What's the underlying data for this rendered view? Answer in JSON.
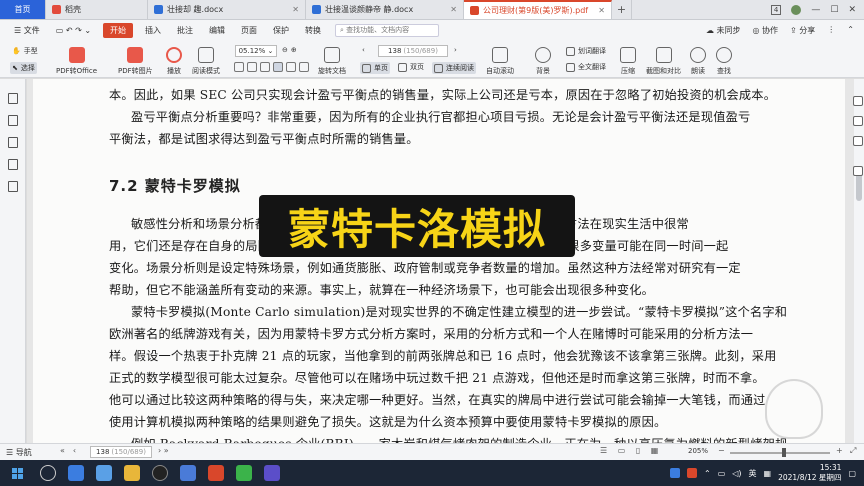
{
  "tabs": {
    "home": "首页",
    "wk": "稻壳",
    "doc1": "壮接却 趣.docx",
    "doc2": "壮接温谈颜静帝 静.docx",
    "pdf": "公司理财(第9版(美)罗斯).pdf",
    "plus": "+"
  },
  "window": {
    "count": "4"
  },
  "menu": {
    "file": "文件",
    "start": "开始",
    "insert": "插入",
    "comment": "批注",
    "edit": "编辑",
    "page": "页面",
    "protect": "保护",
    "convert": "转换",
    "search_placeholder": "查找功能、文档内容",
    "sync": "未同步",
    "collab": "协作",
    "share": "分享"
  },
  "ribbon": {
    "hand": "手型",
    "select": "选择",
    "pdf_office": "PDF转Office",
    "pdf_image": "PDF转图片",
    "play": "播放",
    "read_mode": "阅读模式",
    "zoom": "05.12%",
    "rotate": "旋转文档",
    "single": "单页",
    "double": "双页",
    "continuous": "连续阅读",
    "auto_scroll": "自动滚动",
    "page_current": "138",
    "page_total": "(150/689)",
    "background": "背景",
    "translate_word": "划词翻译",
    "translate_full": "全文翻译",
    "compress": "压缩",
    "screenshot": "截图和对比",
    "read_aloud": "朗读",
    "find": "查找"
  },
  "content": {
    "line1": "本。因此，如果 SEC 公司只实现会计盈亏平衡点的销售量，实际上公司还是亏本，原因在于忽略了初始投资的机会成本。",
    "line2": "盈亏平衡点分析重要吗？非常重要，因为所有的企业执行官都担心项目亏损。无论是会计盈亏平衡法还是现值盈亏",
    "line3": "平衡法，都是试图求得达到盈亏平衡点时所需的销售量。",
    "heading": "7.2   蒙特卡罗模拟",
    "p1": "敏感性分析和场景分析都试图回答“如果……会怎样”的问题，但是，尽管这两种方法在现实生活中很常",
    "p2": "用，它们还是存在自身的局限。敏感性分析一次只允许一个变量变动，而现实生活中很多变量可能在同一时间一起",
    "p3": "变化。场景分析则是设定特殊场景，例如通货膨胀、政府管制或竞争者数量的增加。虽然这种方法经常对研究有一定",
    "p4": "帮助，但它不能涵盖所有变动的来源。事实上，就算在一种经济场景下，也可能会出现很多种变化。",
    "p5": "蒙特卡罗模拟(Monte Carlo simulation)是对现实世界的不确定性建立模型的进一步尝试。“蒙特卡罗模拟”这个名字和",
    "p6": "欧洲著名的纸牌游戏有关，因为用蒙特卡罗方式分析方案时，采用的分析方式和一个人在赌博时可能采用的分析方法一",
    "p7": "样。假设一个热衷于扑克牌 21 点的玩家，当他拿到的前两张牌总和已 16 点时，他会犹豫该不该拿第三张牌。此刻，采用",
    "p8": "正式的数学模型很可能太过复杂。尽管他可以在赌场中玩过数千把 21 点游戏，但他还是时而拿这第三张牌，时而不拿。",
    "p9": "他可以通过比较这两种策略的得与失，来决定哪一种更好。当然，在真实的牌局中进行尝试可能会输掉一大笔钱，而通过",
    "p10": "使用计算机模拟两种策略的结果则避免了损失。这就是为什么资本预算中要使用蒙特卡罗模拟的原因。",
    "p11": "例如 Backyard Barbeques 企业(BBI)，一家木炭和煤气烤肉架的制造企业，正在为一种以高压氢为燃料的新型烤架规"
  },
  "overlay_title": "蒙特卡洛模拟",
  "status": {
    "nav": "导航",
    "page_current": "138",
    "page_total": "(150/689)",
    "zoom": "205%"
  },
  "taskbar": {
    "ime": "英",
    "time": "15:31",
    "date": "2021/8/12 星期四"
  },
  "colors": {
    "accent": "#d9472b",
    "home_tab": "#2b63d9",
    "overlay_bg": "#141414",
    "overlay_text": "#f7d417"
  }
}
